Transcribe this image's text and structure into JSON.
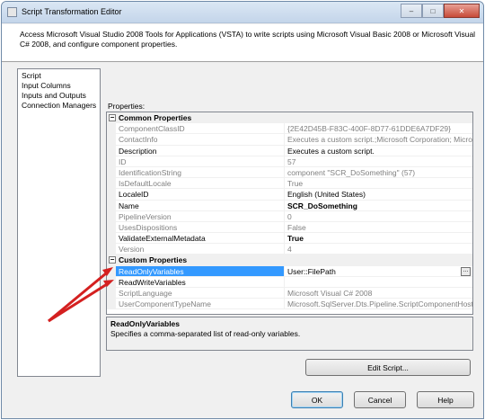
{
  "window": {
    "title": "Script Transformation Editor",
    "caption_buttons": {
      "minimize": "–",
      "maximize": "□",
      "close": "✕"
    }
  },
  "header": {
    "description": "Access Microsoft Visual Studio 2008 Tools for Applications (VSTA) to write scripts using Microsoft Visual Basic 2008 or Microsoft Visual C# 2008, and configure component properties."
  },
  "nav": {
    "items": [
      {
        "label": "Script"
      },
      {
        "label": "Input Columns"
      },
      {
        "label": "Inputs and Outputs"
      },
      {
        "label": "Connection Managers"
      }
    ]
  },
  "properties_label": "Properties:",
  "grid": {
    "common": {
      "title": "Common Properties",
      "toggle": "−",
      "rows": [
        {
          "name": "ComponentClassID",
          "value": "{2E42D45B-F83C-400F-8D77-61DDE6A7DF29}",
          "readonly": true
        },
        {
          "name": "ContactInfo",
          "value": "Executes a custom script.;Microsoft Corporation; Microsoft S",
          "readonly": true
        },
        {
          "name": "Description",
          "value": "Executes a custom script.",
          "readonly": false
        },
        {
          "name": "ID",
          "value": "57",
          "readonly": true
        },
        {
          "name": "IdentificationString",
          "value": "component \"SCR_DoSomething\" (57)",
          "readonly": true
        },
        {
          "name": "IsDefaultLocale",
          "value": "True",
          "readonly": true
        },
        {
          "name": "LocaleID",
          "value": "English (United States)",
          "readonly": false
        },
        {
          "name": "Name",
          "value": "SCR_DoSomething",
          "readonly": false,
          "bold": true
        },
        {
          "name": "PipelineVersion",
          "value": "0",
          "readonly": true
        },
        {
          "name": "UsesDispositions",
          "value": "False",
          "readonly": true
        },
        {
          "name": "ValidateExternalMetadata",
          "value": "True",
          "readonly": false,
          "bold": true
        },
        {
          "name": "Version",
          "value": "4",
          "readonly": true
        }
      ]
    },
    "custom": {
      "title": "Custom Properties",
      "toggle": "−",
      "rows": [
        {
          "name": "ReadOnlyVariables",
          "value": "User::FilePath",
          "readonly": false,
          "selected": true,
          "ellipsis": "..."
        },
        {
          "name": "ReadWriteVariables",
          "value": "",
          "readonly": false
        },
        {
          "name": "ScriptLanguage",
          "value": "Microsoft Visual C# 2008",
          "readonly": true
        },
        {
          "name": "UserComponentTypeName",
          "value": "Microsoft.SqlServer.Dts.Pipeline.ScriptComponentHost, Micr",
          "readonly": true
        }
      ]
    }
  },
  "description_panel": {
    "title": "ReadOnlyVariables",
    "text": "Specifies a comma-separated list of read-only variables."
  },
  "buttons": {
    "edit_script": "Edit Script...",
    "ok": "OK",
    "cancel": "Cancel",
    "help": "Help"
  },
  "colors": {
    "selection": "#3399ff",
    "annotation_arrow": "#d42020",
    "readonly_text": "#808080"
  }
}
